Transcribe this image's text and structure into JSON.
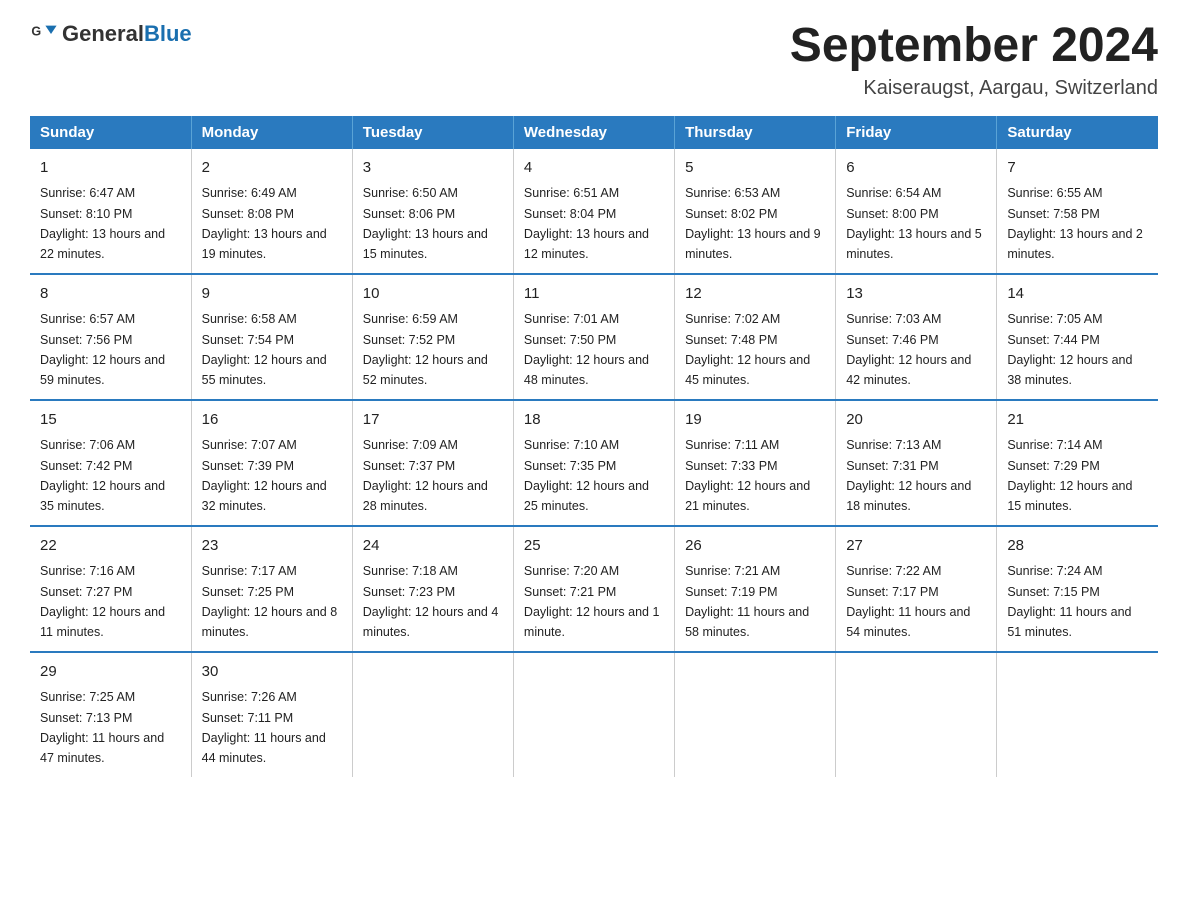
{
  "header": {
    "logo_general": "General",
    "logo_blue": "Blue",
    "title": "September 2024",
    "subtitle": "Kaiseraugst, Aargau, Switzerland"
  },
  "days_of_week": [
    "Sunday",
    "Monday",
    "Tuesday",
    "Wednesday",
    "Thursday",
    "Friday",
    "Saturday"
  ],
  "weeks": [
    [
      {
        "day": "1",
        "sunrise": "6:47 AM",
        "sunset": "8:10 PM",
        "daylight": "13 hours and 22 minutes."
      },
      {
        "day": "2",
        "sunrise": "6:49 AM",
        "sunset": "8:08 PM",
        "daylight": "13 hours and 19 minutes."
      },
      {
        "day": "3",
        "sunrise": "6:50 AM",
        "sunset": "8:06 PM",
        "daylight": "13 hours and 15 minutes."
      },
      {
        "day": "4",
        "sunrise": "6:51 AM",
        "sunset": "8:04 PM",
        "daylight": "13 hours and 12 minutes."
      },
      {
        "day": "5",
        "sunrise": "6:53 AM",
        "sunset": "8:02 PM",
        "daylight": "13 hours and 9 minutes."
      },
      {
        "day": "6",
        "sunrise": "6:54 AM",
        "sunset": "8:00 PM",
        "daylight": "13 hours and 5 minutes."
      },
      {
        "day": "7",
        "sunrise": "6:55 AM",
        "sunset": "7:58 PM",
        "daylight": "13 hours and 2 minutes."
      }
    ],
    [
      {
        "day": "8",
        "sunrise": "6:57 AM",
        "sunset": "7:56 PM",
        "daylight": "12 hours and 59 minutes."
      },
      {
        "day": "9",
        "sunrise": "6:58 AM",
        "sunset": "7:54 PM",
        "daylight": "12 hours and 55 minutes."
      },
      {
        "day": "10",
        "sunrise": "6:59 AM",
        "sunset": "7:52 PM",
        "daylight": "12 hours and 52 minutes."
      },
      {
        "day": "11",
        "sunrise": "7:01 AM",
        "sunset": "7:50 PM",
        "daylight": "12 hours and 48 minutes."
      },
      {
        "day": "12",
        "sunrise": "7:02 AM",
        "sunset": "7:48 PM",
        "daylight": "12 hours and 45 minutes."
      },
      {
        "day": "13",
        "sunrise": "7:03 AM",
        "sunset": "7:46 PM",
        "daylight": "12 hours and 42 minutes."
      },
      {
        "day": "14",
        "sunrise": "7:05 AM",
        "sunset": "7:44 PM",
        "daylight": "12 hours and 38 minutes."
      }
    ],
    [
      {
        "day": "15",
        "sunrise": "7:06 AM",
        "sunset": "7:42 PM",
        "daylight": "12 hours and 35 minutes."
      },
      {
        "day": "16",
        "sunrise": "7:07 AM",
        "sunset": "7:39 PM",
        "daylight": "12 hours and 32 minutes."
      },
      {
        "day": "17",
        "sunrise": "7:09 AM",
        "sunset": "7:37 PM",
        "daylight": "12 hours and 28 minutes."
      },
      {
        "day": "18",
        "sunrise": "7:10 AM",
        "sunset": "7:35 PM",
        "daylight": "12 hours and 25 minutes."
      },
      {
        "day": "19",
        "sunrise": "7:11 AM",
        "sunset": "7:33 PM",
        "daylight": "12 hours and 21 minutes."
      },
      {
        "day": "20",
        "sunrise": "7:13 AM",
        "sunset": "7:31 PM",
        "daylight": "12 hours and 18 minutes."
      },
      {
        "day": "21",
        "sunrise": "7:14 AM",
        "sunset": "7:29 PM",
        "daylight": "12 hours and 15 minutes."
      }
    ],
    [
      {
        "day": "22",
        "sunrise": "7:16 AM",
        "sunset": "7:27 PM",
        "daylight": "12 hours and 11 minutes."
      },
      {
        "day": "23",
        "sunrise": "7:17 AM",
        "sunset": "7:25 PM",
        "daylight": "12 hours and 8 minutes."
      },
      {
        "day": "24",
        "sunrise": "7:18 AM",
        "sunset": "7:23 PM",
        "daylight": "12 hours and 4 minutes."
      },
      {
        "day": "25",
        "sunrise": "7:20 AM",
        "sunset": "7:21 PM",
        "daylight": "12 hours and 1 minute."
      },
      {
        "day": "26",
        "sunrise": "7:21 AM",
        "sunset": "7:19 PM",
        "daylight": "11 hours and 58 minutes."
      },
      {
        "day": "27",
        "sunrise": "7:22 AM",
        "sunset": "7:17 PM",
        "daylight": "11 hours and 54 minutes."
      },
      {
        "day": "28",
        "sunrise": "7:24 AM",
        "sunset": "7:15 PM",
        "daylight": "11 hours and 51 minutes."
      }
    ],
    [
      {
        "day": "29",
        "sunrise": "7:25 AM",
        "sunset": "7:13 PM",
        "daylight": "11 hours and 47 minutes."
      },
      {
        "day": "30",
        "sunrise": "7:26 AM",
        "sunset": "7:11 PM",
        "daylight": "11 hours and 44 minutes."
      },
      null,
      null,
      null,
      null,
      null
    ]
  ],
  "labels": {
    "sunrise": "Sunrise:",
    "sunset": "Sunset:",
    "daylight": "Daylight:"
  }
}
